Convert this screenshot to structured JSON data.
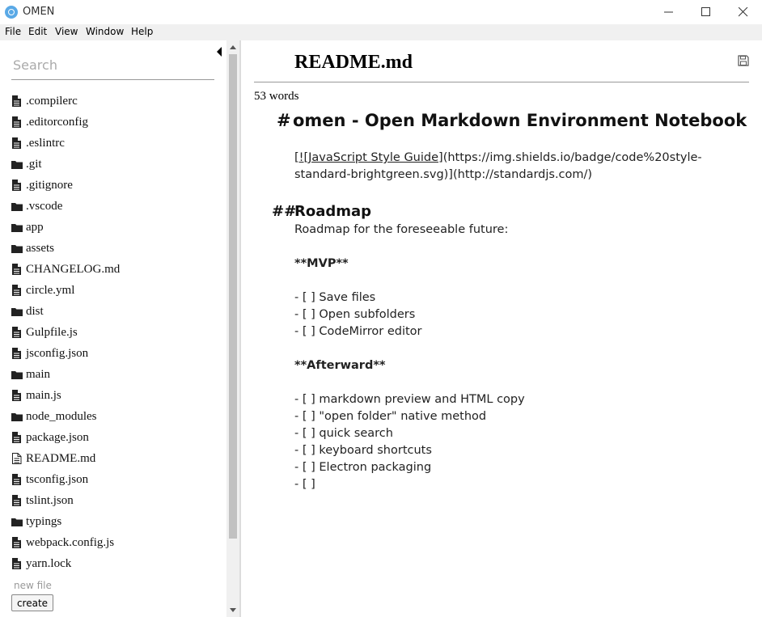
{
  "window": {
    "title": "OMEN",
    "controls": {
      "minimize": "minimize-icon",
      "maximize": "maximize-icon",
      "close": "close-icon"
    }
  },
  "menu": [
    "File",
    "Edit",
    "View",
    "Window",
    "Help"
  ],
  "sidebar": {
    "search_placeholder": "Search",
    "files": [
      {
        "name": ".compilerc",
        "type": "file"
      },
      {
        "name": ".editorconfig",
        "type": "file"
      },
      {
        "name": ".eslintrc",
        "type": "file"
      },
      {
        "name": ".git",
        "type": "folder"
      },
      {
        "name": ".gitignore",
        "type": "file"
      },
      {
        "name": ".vscode",
        "type": "folder"
      },
      {
        "name": "app",
        "type": "folder"
      },
      {
        "name": "assets",
        "type": "folder"
      },
      {
        "name": "CHANGELOG.md",
        "type": "file"
      },
      {
        "name": "circle.yml",
        "type": "file"
      },
      {
        "name": "dist",
        "type": "folder"
      },
      {
        "name": "Gulpfile.js",
        "type": "file"
      },
      {
        "name": "jsconfig.json",
        "type": "file"
      },
      {
        "name": "main",
        "type": "folder"
      },
      {
        "name": "main.js",
        "type": "file"
      },
      {
        "name": "node_modules",
        "type": "folder"
      },
      {
        "name": "package.json",
        "type": "file"
      },
      {
        "name": "README.md",
        "type": "file-outline"
      },
      {
        "name": "tsconfig.json",
        "type": "file"
      },
      {
        "name": "tslint.json",
        "type": "file"
      },
      {
        "name": "typings",
        "type": "folder"
      },
      {
        "name": "webpack.config.js",
        "type": "file"
      },
      {
        "name": "yarn.lock",
        "type": "file"
      }
    ],
    "new_file_placeholder": "new file",
    "create_label": "create"
  },
  "editor": {
    "title": "README.md",
    "word_count": "53 words",
    "h1_marker": "#",
    "h1_text": "omen - Open Markdown Environment Notebook",
    "badge_link_text": "[![JavaScript Style Guide]",
    "badge_line1_rest": "(https://img.shields.io/badge/code%20style-",
    "badge_line2_a": "standard-brightgreen.svg)]",
    "badge_line2_b": "(http://standardjs.com/)",
    "h2_marker": "##",
    "h2_text": "Roadmap",
    "roadmap_intro": "Roadmap for the foreseeable future:",
    "mvp_heading": "**MVP**",
    "mvp_items": [
      "- [ ] Save files",
      "- [ ] Open subfolders",
      "- [ ] CodeMirror editor"
    ],
    "afterward_heading": "**Afterward**",
    "afterward_items": [
      "- [ ] markdown preview and HTML copy",
      "- [ ] \"open folder\" native method",
      "- [ ] quick search",
      "- [ ] keyboard shortcuts",
      "- [ ] Electron packaging",
      "- [ ]"
    ]
  }
}
